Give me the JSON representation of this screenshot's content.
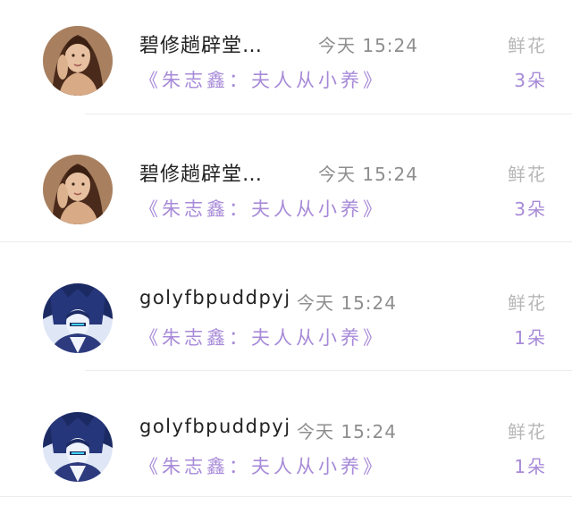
{
  "list": {
    "rows": [
      {
        "name": "碧修趟辟堂…",
        "time": "今天 15:24",
        "flower_label": "鲜花",
        "book": "《朱志鑫：夫人从小养》",
        "count": "3朵",
        "avatar": "portrait-photo"
      },
      {
        "name": "碧修趟辟堂…",
        "time": "今天 15:24",
        "flower_label": "鲜花",
        "book": "《朱志鑫：夫人从小养》",
        "count": "3朵",
        "avatar": "portrait-photo"
      },
      {
        "name": "golyfbpuddpyj",
        "time": "今天 15:24",
        "flower_label": "鲜花",
        "book": "《朱志鑫：夫人从小养》",
        "count": "1朵",
        "avatar": "anime-character"
      },
      {
        "name": "golyfbpuddpyj",
        "time": "今天 15:24",
        "flower_label": "鲜花",
        "book": "《朱志鑫：夫人从小养》",
        "count": "1朵",
        "avatar": "anime-character"
      }
    ]
  },
  "colors": {
    "name": "#222222",
    "time": "#8e8e8e",
    "flower_label": "#b7b7b7",
    "accent_purple": "#a78ad8",
    "divider": "#ececec"
  }
}
